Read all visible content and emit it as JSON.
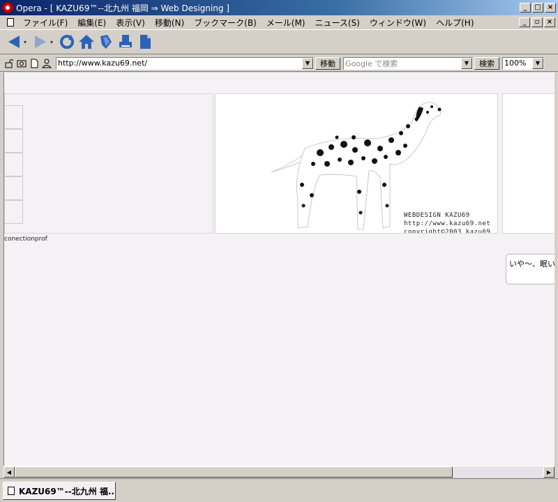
{
  "window": {
    "title": "Opera - [ KAZU69™--北九州 福岡 ⇒ Web Designing ]",
    "minimize": "_",
    "maximize": "□",
    "close": "×",
    "restore": "▫"
  },
  "menu": {
    "items": [
      "ファイル(F)",
      "編集(E)",
      "表示(V)",
      "移動(N)",
      "ブックマーク(B)",
      "メール(M)",
      "ニュース(S)",
      "ウィンドウ(W)",
      "ヘルプ(H)"
    ]
  },
  "toolbar": {
    "icons": [
      "back-arrow-icon",
      "forward-arrow-icon",
      "reload-icon",
      "home-icon",
      "hotlist-icon",
      "print-icon",
      "page-icon"
    ],
    "colors": {
      "blue": "#2c63b8",
      "gray_arrow": "#8fa6c8"
    }
  },
  "address": {
    "url": "http://www.kazu69.net/",
    "go_label": "移動",
    "search_placeholder": "Google で検索",
    "search_button": "検索",
    "zoom": "100%"
  },
  "page": {
    "hero_caption_line1": "WEBDESIGN KAZU69",
    "hero_caption_line2": "http://www.kazu69.net",
    "hero_caption_line3": "copyright©2003 kazu69",
    "connect_text": "conectionprof",
    "speech_text": "いや〜、眠い"
  },
  "tabs": {
    "active_label": "KAZU69™--北九州 福..."
  }
}
